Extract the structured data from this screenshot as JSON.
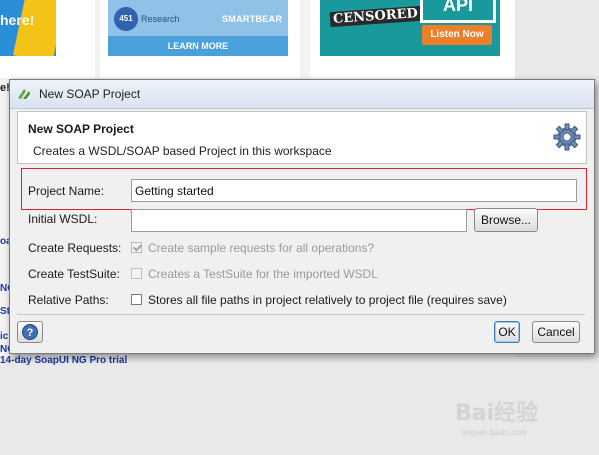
{
  "background": {
    "banner1_text": "here!",
    "banner2": {
      "badge": "451",
      "research": "Research",
      "brand": "SMARTBEAR",
      "cta": "LEARN MORE"
    },
    "banner3": {
      "censored": "CENSORED",
      "api": "API",
      "cta": "Listen Now"
    },
    "exclaim": "e!",
    "left_links": [
      "oa",
      "NG",
      "St",
      "ic",
      "NG"
    ],
    "trial_link": "14-day SoapUI NG Pro trial"
  },
  "dialog": {
    "window_title": "New SOAP Project",
    "header": {
      "title": "New SOAP Project",
      "description": "Creates a WSDL/SOAP based Project in this workspace"
    },
    "fields": {
      "project_name": {
        "label": "Project Name:",
        "value": "Getting started"
      },
      "initial_wsdl": {
        "label": "Initial WSDL:",
        "value": "",
        "browse_label": "Browse..."
      }
    },
    "options": {
      "create_requests": {
        "label": "Create Requests:",
        "text": "Create sample requests for all operations?",
        "checked": true,
        "enabled": false
      },
      "create_testsuite": {
        "label": "Create TestSuite:",
        "text": "Creates a TestSuite for the imported WSDL",
        "checked": false,
        "enabled": false
      },
      "relative_paths": {
        "label": "Relative Paths:",
        "text": "Stores all file paths in project relatively to project file (requires save)",
        "checked": false,
        "enabled": true
      }
    },
    "buttons": {
      "ok": "OK",
      "cancel": "Cancel",
      "help": "?"
    }
  },
  "watermark": {
    "brand": "Bai经验",
    "url": "jingyan.baidu.com"
  },
  "colors": {
    "highlight": "#d9242d",
    "ok_border": "#3c7fb1",
    "link": "#1a3aa0"
  }
}
